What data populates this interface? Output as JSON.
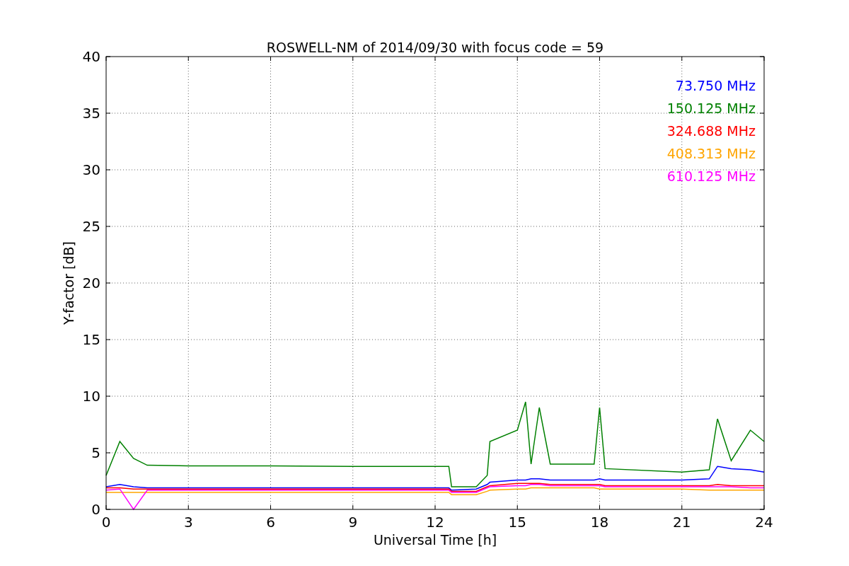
{
  "figure": {
    "chart_data": {
      "type": "line",
      "title": "ROSWELL-NM of 2014/09/30 with focus code = 59",
      "xlabel": "Universal Time [h]",
      "ylabel": "Y-factor [dB]",
      "x": [
        0,
        0.5,
        1,
        1.5,
        3,
        6,
        9,
        12.5,
        12.6,
        13.5,
        13.9,
        14,
        15,
        15.3,
        15.5,
        15.8,
        16.2,
        17.8,
        18,
        18.2,
        21,
        22,
        22.3,
        22.8,
        23.5,
        24
      ],
      "series": [
        {
          "name": "73.750 MHz",
          "color": "#0000ff",
          "values": [
            2,
            2.2,
            2,
            1.9,
            1.9,
            1.9,
            1.9,
            1.9,
            1.7,
            1.8,
            2.2,
            2.4,
            2.6,
            2.6,
            2.7,
            2.7,
            2.6,
            2.6,
            2.7,
            2.6,
            2.6,
            2.7,
            3.8,
            3.6,
            3.5,
            3.3
          ]
        },
        {
          "name": "150.125 MHz",
          "color": "#008000",
          "values": [
            3,
            6,
            4.5,
            3.9,
            3.85,
            3.85,
            3.8,
            3.8,
            2,
            2,
            3,
            6,
            7,
            9.5,
            4,
            9,
            4,
            4,
            9,
            3.6,
            3.3,
            3.5,
            8,
            4.3,
            7,
            6
          ]
        },
        {
          "name": "324.688 MHz",
          "color": "#ff0000",
          "values": [
            1.9,
            1.9,
            1.8,
            1.8,
            1.8,
            1.8,
            1.8,
            1.8,
            1.6,
            1.6,
            2,
            2.1,
            2.3,
            2.3,
            2.3,
            2.3,
            2.2,
            2.2,
            2.2,
            2.1,
            2.1,
            2.1,
            2.2,
            2.1,
            2.1,
            2.1
          ]
        },
        {
          "name": "408.313 MHz",
          "color": "#ffa500",
          "values": [
            1.5,
            1.5,
            1.5,
            1.5,
            1.5,
            1.5,
            1.5,
            1.5,
            1.3,
            1.3,
            1.6,
            1.7,
            1.8,
            1.8,
            1.9,
            1.9,
            1.9,
            1.9,
            1.8,
            1.8,
            1.8,
            1.7,
            1.7,
            1.7,
            1.7,
            1.7
          ]
        },
        {
          "name": "610.125 MHz",
          "color": "#ff00ff",
          "values": [
            1.7,
            1.8,
            0,
            1.7,
            1.7,
            1.7,
            1.7,
            1.7,
            1.5,
            1.5,
            1.9,
            2,
            2.1,
            2.1,
            2.2,
            2.2,
            2.1,
            2.1,
            2.1,
            2,
            2,
            2,
            2,
            2,
            1.9,
            1.9
          ]
        }
      ],
      "grid": true,
      "xlim": [
        0,
        24
      ],
      "ylim": [
        0,
        40
      ],
      "xticks": [
        0,
        3,
        6,
        9,
        12,
        15,
        18,
        21,
        24
      ],
      "yticks": [
        0,
        5,
        10,
        15,
        20,
        25,
        30,
        35,
        40
      ]
    }
  }
}
